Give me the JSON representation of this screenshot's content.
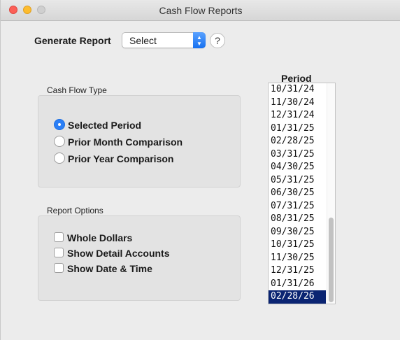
{
  "window": {
    "title": "Cash Flow Reports"
  },
  "generate": {
    "label": "Generate Report",
    "selected": "Select",
    "help": "?"
  },
  "cash_flow_type": {
    "label": "Cash Flow Type",
    "options": [
      {
        "label": "Selected Period",
        "selected": true
      },
      {
        "label": "Prior Month Comparison",
        "selected": false
      },
      {
        "label": "Prior Year Comparison",
        "selected": false
      }
    ]
  },
  "report_options": {
    "label": "Report Options",
    "options": [
      {
        "label": "Whole Dollars",
        "checked": false
      },
      {
        "label": "Show Detail Accounts",
        "checked": false
      },
      {
        "label": "Show Date & Time",
        "checked": false
      }
    ]
  },
  "period": {
    "header": "Period",
    "items": [
      "10/31/24",
      "11/30/24",
      "12/31/24",
      "01/31/25",
      "02/28/25",
      "03/31/25",
      "04/30/25",
      "05/31/25",
      "06/30/25",
      "07/31/25",
      "08/31/25",
      "09/30/25",
      "10/31/25",
      "11/30/25",
      "12/31/25",
      "01/31/26",
      "02/28/26"
    ],
    "selected_index": 16,
    "scroll_position": 1.0,
    "visible_fraction": 0.62
  },
  "colors": {
    "accent": "#2b7ff6",
    "selection": "#0a2472"
  },
  "icons": {
    "select_stepper": "chevron-up-down-icon",
    "help": "question-mark-icon"
  }
}
